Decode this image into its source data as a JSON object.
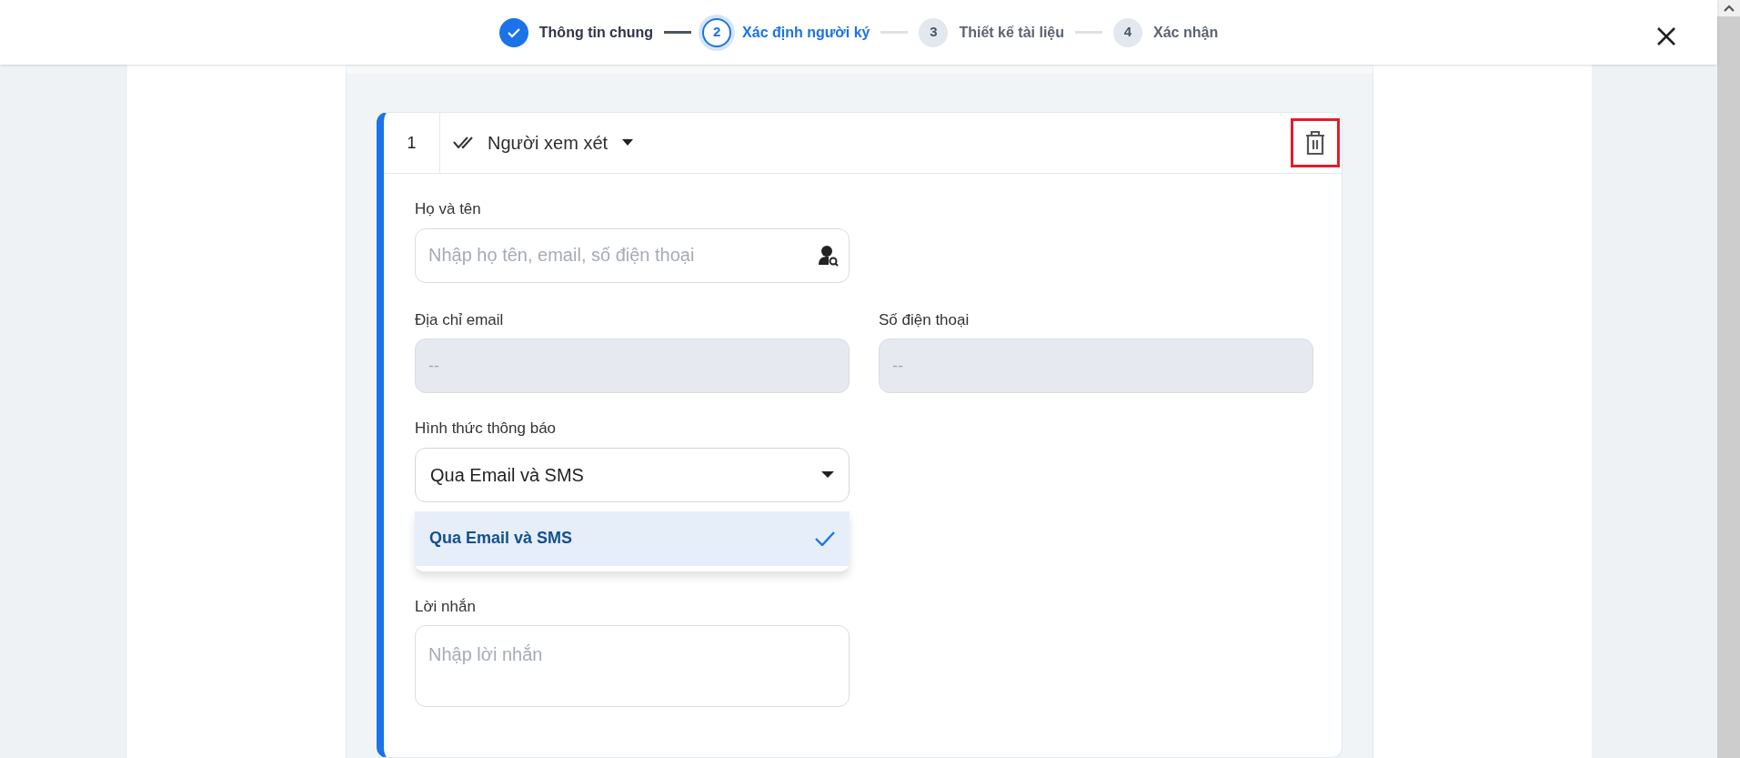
{
  "stepper": [
    {
      "label": "Thông tin chung",
      "completed": true,
      "selected": false
    },
    {
      "number": "2",
      "label": "Xác định người ký",
      "completed": false,
      "selected": true
    },
    {
      "number": "3",
      "label": "Thiết kế tài liệu",
      "completed": false,
      "selected": false
    },
    {
      "number": "4",
      "label": "Xác nhận",
      "completed": false,
      "selected": false
    }
  ],
  "signer_card": {
    "index": "1",
    "role": "Người xem xét",
    "delete_highlighted": true,
    "full_name": {
      "label": "Họ và tên",
      "placeholder": "Nhập họ tên, email, số điện thoại"
    },
    "email": {
      "label": "Địa chỉ email",
      "placeholder": "--",
      "disabled": true
    },
    "phone": {
      "label": "Số điện thoại",
      "placeholder": "--",
      "disabled": true
    },
    "notification": {
      "label": "Hình thức thông báo",
      "value": "Qua Email và SMS",
      "expanded": true,
      "options": [
        {
          "label": "Qua Email và SMS",
          "selected": true
        }
      ]
    },
    "message": {
      "label": "Lời nhắn",
      "placeholder": "Nhập lời nhắn"
    }
  }
}
